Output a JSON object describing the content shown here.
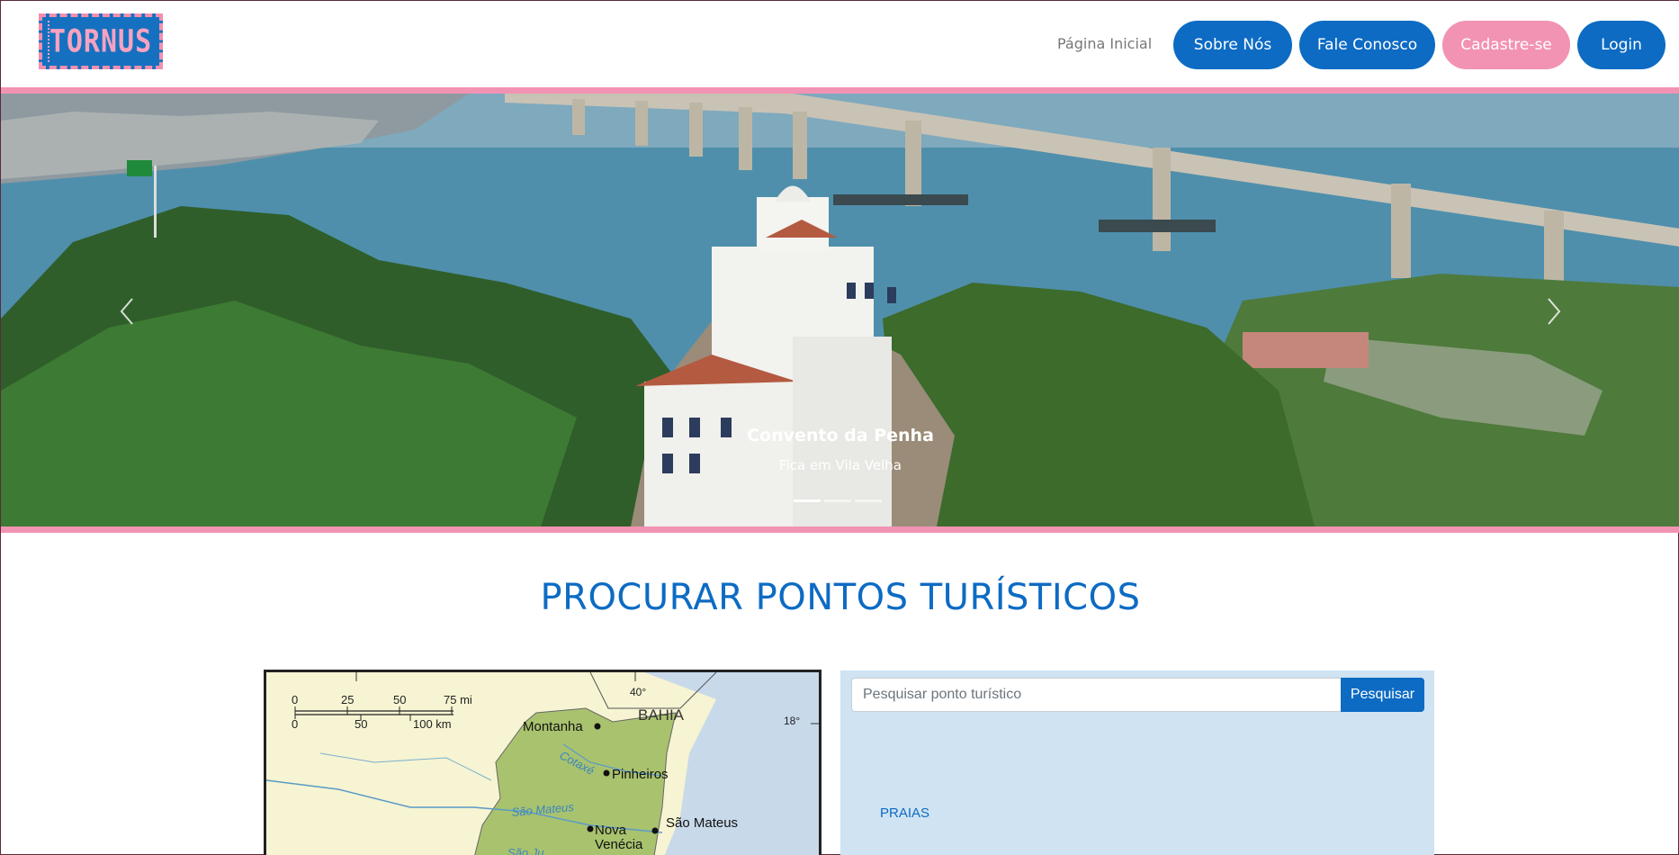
{
  "brand": {
    "logo_text": "TORNUS"
  },
  "nav": {
    "home": "Página Inicial",
    "about": "Sobre Nós",
    "contact": "Fale Conosco",
    "signup": "Cadastre-se",
    "login": "Login"
  },
  "colors": {
    "primary": "#0d6bc3",
    "accent_pink": "#f293b3",
    "panel_bg": "#cfe3f2"
  },
  "carousel": {
    "title": "Convento da Penha",
    "subtitle": "Fica em Vila Velha",
    "slide_count": 3,
    "active_index": 0,
    "prev_icon": "chevron-left-icon",
    "next_icon": "chevron-right-icon"
  },
  "section": {
    "title": "PROCURAR PONTOS TURÍSTICOS"
  },
  "map": {
    "scale_mi": [
      "0",
      "25",
      "50",
      "75 mi"
    ],
    "scale_km": [
      "0",
      "50",
      "100 km"
    ],
    "lat_40": "40°",
    "lat_18": "18°",
    "region": "BAHIA",
    "cities": [
      "Montanha",
      "Pinheiros",
      "São Mateus",
      "Nova",
      "Venécia"
    ],
    "rivers": [
      "Cotaxé",
      "São Mateus",
      "São Ju"
    ]
  },
  "search": {
    "placeholder": "Pesquisar ponto turístico",
    "button": "Pesquisar",
    "category": "PRAIAS"
  }
}
